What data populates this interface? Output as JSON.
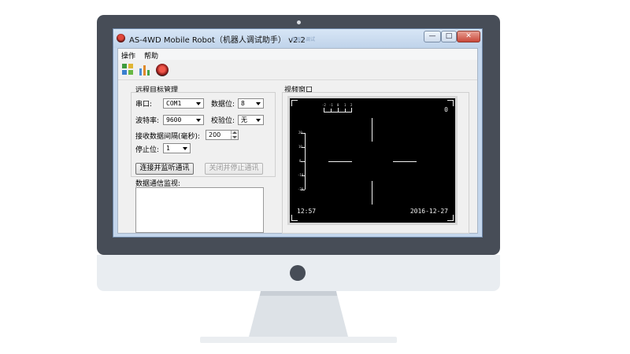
{
  "window": {
    "title": "AS-4WD Mobile Robot（机器人调试助手） v2.2",
    "ghost_text": "机器人调试",
    "min_glyph": "—",
    "max_glyph": "□",
    "close_glyph": "✕"
  },
  "menu": {
    "items": [
      "操作",
      "帮助"
    ]
  },
  "toolbar": {
    "icons": [
      "grid-icon",
      "bar-chart-icon",
      "robot-icon"
    ]
  },
  "remote": {
    "title": "远程目标管理",
    "port_label": "串口:",
    "port_value": "COM1",
    "databits_label": "数据位:",
    "databits_value": "8",
    "baud_label": "波特率:",
    "baud_value": "9600",
    "parity_label": "校验位:",
    "parity_value": "无",
    "interval_label": "接收数据间隔(毫秒):",
    "interval_value": "200",
    "stopbits_label": "停止位:",
    "stopbits_value": "1",
    "connect_button": "连接并监听通讯",
    "disconnect_button": "关闭并停止通讯",
    "monitor_label": "数据通信监视:"
  },
  "video": {
    "title": "视频窗口",
    "counter": "0",
    "time": "12:57",
    "date": "2016-12-27",
    "scale_top": [
      "-2",
      "-1",
      "0",
      "1",
      "2"
    ],
    "scale_left": [
      "20",
      "10",
      "0",
      "-10",
      "-20"
    ]
  },
  "colors": {
    "window_frame": "#c4d6ec",
    "video_bg": "#000000",
    "monitor": "#474d57"
  }
}
